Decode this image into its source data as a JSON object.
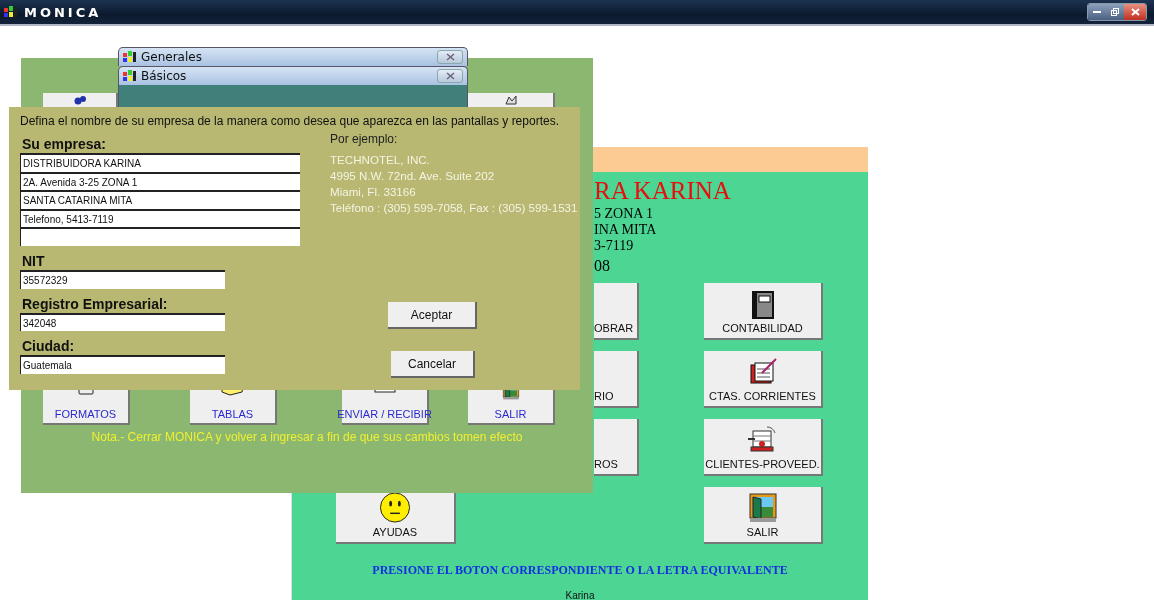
{
  "app": {
    "title": "MONICA"
  },
  "main_menu": {
    "header_lines": [
      "RA KARINA",
      "5 ZONA 1",
      "INA MITA",
      "3-7119",
      "08"
    ],
    "buttons": [
      {
        "label": "OBRAR",
        "kind": "partial"
      },
      {
        "label": "CONTABILIDAD",
        "kind": "full"
      },
      {
        "label": "RIO",
        "kind": "partial"
      },
      {
        "label": "CTAS. CORRIENTES",
        "kind": "full"
      },
      {
        "label": "ROS",
        "kind": "partial"
      },
      {
        "label": "CLIENTES-PROVEED.",
        "kind": "full"
      },
      {
        "label": "AYUDAS",
        "kind": "full"
      },
      {
        "label": "SALIR",
        "kind": "full"
      }
    ],
    "footer": "PRESIONE EL BOTON CORRESPONDIENTE O LA LETRA EQUIVALENTE",
    "user": "Karina"
  },
  "generales_window": {
    "title": "Generales",
    "buttons": [
      {
        "label": "FORMATOS"
      },
      {
        "label": "TABLAS"
      },
      {
        "label": "ENVIAR / RECIBIR"
      },
      {
        "label": "SALIR"
      }
    ],
    "note": "Nota.- Cerrar MONICA y volver a ingresar a fin de que sus cambios tomen efecto"
  },
  "basicos_window": {
    "title": "Básicos"
  },
  "company_dialog": {
    "instruction": "Defina el nombre de su empresa de la manera como desea que aparezca en las pantallas y reportes.",
    "company_label": "Su empresa:",
    "company_fields": [
      {
        "kind": "filled",
        "value": "DISTRIBUIDORA KARINA"
      },
      {
        "kind": "filled",
        "value": "2A. Avenida 3-25 ZONA 1"
      },
      {
        "kind": "filled",
        "value": "SANTA CATARINA MITA"
      },
      {
        "kind": "filled",
        "value": "Telefono, 5413-7119"
      },
      {
        "kind": "empty"
      }
    ],
    "fields": [
      {
        "label": "NIT",
        "value": "35572329"
      },
      {
        "label": "Registro Empresarial:",
        "value": "342048"
      },
      {
        "label": "Ciudad:",
        "value": "Guatemala"
      }
    ],
    "example_label": "Por ejemplo:",
    "example_lines": [
      "TECHNOTEL, INC.",
      "4995 N.W. 72nd. Ave. Suite 202",
      "Miami, Fl. 33166",
      "Teléfono : (305) 599-7058, Fax : (305) 599-1531"
    ],
    "buttons": [
      "Aceptar",
      "Cancelar"
    ]
  }
}
